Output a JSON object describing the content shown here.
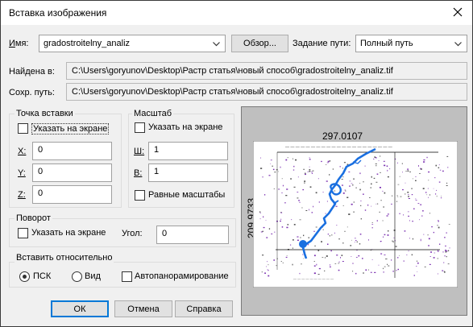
{
  "window": {
    "title": "Вставка изображения"
  },
  "name": {
    "label": "Имя:",
    "value": "gradostroitelny_analiz",
    "browse_label": "Обзор...",
    "path_mode_label": "Задание пути:",
    "path_mode_value": "Полный путь"
  },
  "found_in": {
    "label": "Найдена в:",
    "value": "C:\\Users\\goryunov\\Desktop\\Растр статья\\новый способ\\gradostroitelny_analiz.tif"
  },
  "saved_path": {
    "label": "Сохр. путь:",
    "value": "C:\\Users\\goryunov\\Desktop\\Растр статья\\новый способ\\gradostroitelny_analiz.tif"
  },
  "insertion_point": {
    "title": "Точка вставки",
    "specify_on_screen": "Указать на экране",
    "specify_checked": false,
    "x_label": "X:",
    "x_value": "0",
    "y_label": "Y:",
    "y_value": "0",
    "z_label": "Z:",
    "z_value": "0"
  },
  "scale": {
    "title": "Масштаб",
    "specify_on_screen": "Указать на экране",
    "specify_checked": false,
    "w_label": "Ш:",
    "w_value": "1",
    "h_label": "В:",
    "h_value": "1",
    "uniform_label": "Равные масштабы",
    "uniform_checked": false
  },
  "rotation": {
    "title": "Поворот",
    "specify_on_screen": "Указать на экране",
    "specify_checked": false,
    "angle_label": "Угол:",
    "angle_value": "0"
  },
  "insert_relative": {
    "title": "Вставить относительно",
    "options": [
      "ПСК",
      "Вид"
    ],
    "selected": "ПСК",
    "autopan_label": "Автопанорамирование",
    "autopan_checked": false
  },
  "preview": {
    "width_label": "297.0107",
    "height_label": "209.9733"
  },
  "buttons": {
    "ok": "ОК",
    "cancel": "Отмена",
    "help": "Справка"
  },
  "colors": {
    "accent": "#0078d7",
    "map_blue": "#1a6fe0",
    "map_purple": "#7a2fb0"
  }
}
